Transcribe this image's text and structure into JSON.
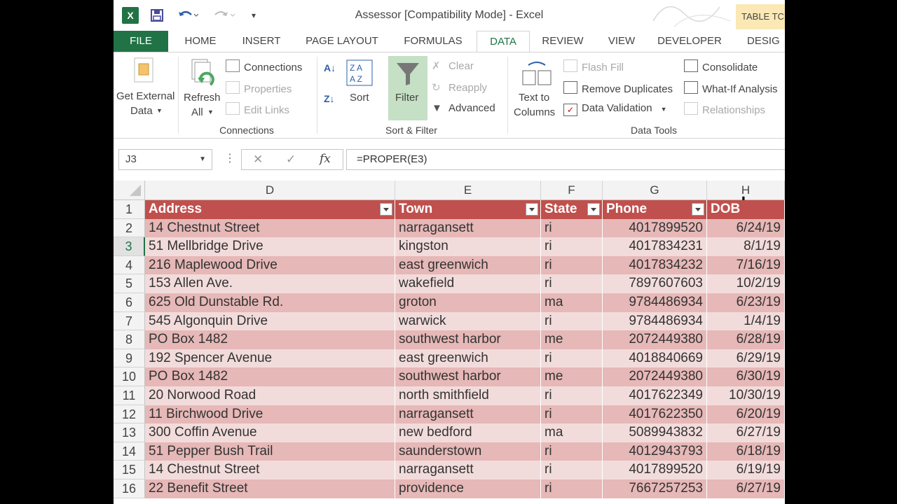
{
  "window": {
    "title": "Assessor  [Compatibility Mode] - Excel",
    "contextual_tab": "TABLE TC"
  },
  "tabs": [
    {
      "label": "FILE"
    },
    {
      "label": "HOME"
    },
    {
      "label": "INSERT"
    },
    {
      "label": "PAGE LAYOUT"
    },
    {
      "label": "FORMULAS"
    },
    {
      "label": "DATA"
    },
    {
      "label": "REVIEW"
    },
    {
      "label": "VIEW"
    },
    {
      "label": "DEVELOPER"
    },
    {
      "label": "DESIG"
    }
  ],
  "active_tab": "DATA",
  "ribbon": {
    "get_external_1": "Get External",
    "get_external_2": "Data",
    "refresh_1": "Refresh",
    "refresh_2": "All",
    "connections": "Connections",
    "properties": "Properties",
    "edit_links": "Edit Links",
    "group_connections": "Connections",
    "sort": "Sort",
    "filter": "Filter",
    "clear": "Clear",
    "reapply": "Reapply",
    "advanced": "Advanced",
    "group_sort_filter": "Sort & Filter",
    "text_to_1": "Text to",
    "text_to_2": "Columns",
    "flash_fill": "Flash Fill",
    "remove_duplicates": "Remove Duplicates",
    "data_validation": "Data Validation",
    "consolidate": "Consolidate",
    "what_if": "What-If Analysis",
    "relationships": "Relationships",
    "group_data_tools": "Data Tools"
  },
  "formula_bar": {
    "name_box": "J3",
    "formula": "=PROPER(E3)"
  },
  "grid": {
    "columns": [
      "D",
      "E",
      "F",
      "G",
      "H"
    ],
    "headers": [
      "Address",
      "Town",
      "State",
      "Phone",
      "DOB"
    ],
    "rows": [
      {
        "n": "2",
        "address": "14 Chestnut Street",
        "town": "narragansett",
        "state": "ri",
        "phone": "4017899520",
        "dob": "6/24/19"
      },
      {
        "n": "3",
        "address": "51 Mellbridge Drive",
        "town": "kingston",
        "state": "ri",
        "phone": "4017834231",
        "dob": "8/1/19"
      },
      {
        "n": "4",
        "address": "216 Maplewood Drive",
        "town": "east greenwich",
        "state": "ri",
        "phone": "4017834232",
        "dob": "7/16/19"
      },
      {
        "n": "5",
        "address": "153 Allen Ave.",
        "town": "wakefield",
        "state": "ri",
        "phone": "7897607603",
        "dob": "10/2/19"
      },
      {
        "n": "6",
        "address": "625 Old Dunstable Rd.",
        "town": "groton",
        "state": "ma",
        "phone": "9784486934",
        "dob": "6/23/19"
      },
      {
        "n": "7",
        "address": "545 Algonquin Drive",
        "town": "warwick",
        "state": "ri",
        "phone": "9784486934",
        "dob": "1/4/19"
      },
      {
        "n": "8",
        "address": "PO Box 1482",
        "town": "southwest harbor",
        "state": "me",
        "phone": "2072449380",
        "dob": "6/28/19"
      },
      {
        "n": "9",
        "address": "192 Spencer Avenue",
        "town": "east greenwich",
        "state": "ri",
        "phone": "4018840669",
        "dob": "6/29/19"
      },
      {
        "n": "10",
        "address": "PO Box 1482",
        "town": "southwest harbor",
        "state": "me",
        "phone": "2072449380",
        "dob": "6/30/19"
      },
      {
        "n": "11",
        "address": "20 Norwood Road",
        "town": "north smithfield",
        "state": "ri",
        "phone": "4017622349",
        "dob": "10/30/19"
      },
      {
        "n": "12",
        "address": "11 Birchwood Drive",
        "town": "narragansett",
        "state": "ri",
        "phone": "4017622350",
        "dob": "6/20/19"
      },
      {
        "n": "13",
        "address": "300 Coffin Avenue",
        "town": "new bedford",
        "state": "ma",
        "phone": "5089943832",
        "dob": "6/27/19"
      },
      {
        "n": "14",
        "address": "51 Pepper Bush Trail",
        "town": "saunderstown",
        "state": "ri",
        "phone": "4012943793",
        "dob": "6/18/19"
      },
      {
        "n": "15",
        "address": "14 Chestnut Street",
        "town": "narragansett",
        "state": "ri",
        "phone": "4017899520",
        "dob": "6/19/19"
      },
      {
        "n": "16",
        "address": "22 Benefit Street",
        "town": "providence",
        "state": "ri",
        "phone": "7667257253",
        "dob": "6/27/19"
      }
    ]
  },
  "colors": {
    "excel_green": "#217346",
    "table_header": "#c0504d",
    "band_dark": "#e6b8b7",
    "band_light": "#f2dcdb"
  },
  "icons": [
    "excel-logo-icon",
    "save-icon",
    "undo-icon",
    "redo-icon",
    "customize-qat-icon",
    "get-external-data-icon",
    "refresh-all-icon",
    "connections-icon",
    "properties-icon",
    "edit-links-icon",
    "sort-asc-icon",
    "sort-desc-icon",
    "sort-az-icon",
    "filter-icon",
    "clear-icon",
    "reapply-icon",
    "advanced-icon",
    "text-to-columns-icon",
    "flash-fill-icon",
    "remove-duplicates-icon",
    "data-validation-icon",
    "consolidate-icon",
    "what-if-icon",
    "relationships-icon",
    "cancel-icon",
    "enter-icon",
    "insert-function-icon"
  ]
}
